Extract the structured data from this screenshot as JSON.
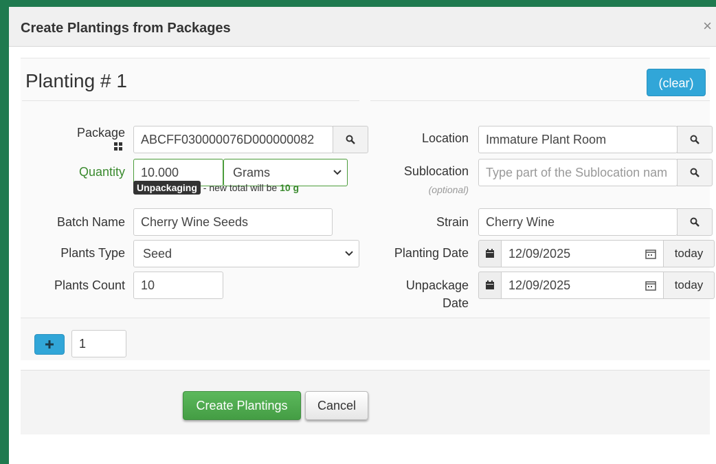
{
  "dialog": {
    "title": "Create Plantings from Packages",
    "close_symbol": "×"
  },
  "planting": {
    "heading": "Planting # 1",
    "clear_label": "(clear)"
  },
  "left_form": {
    "package": {
      "label": "Package",
      "value": "ABCFF030000076D000000082",
      "icon": "grid-icon"
    },
    "quantity": {
      "label": "Quantity",
      "value": "10.000",
      "unit": "Grams"
    },
    "unpackaging": {
      "badge": "Unpackaging",
      "text": "- new total will be",
      "total": "10 g"
    },
    "batch_name": {
      "label": "Batch Name",
      "value": "Cherry Wine Seeds"
    },
    "plants_type": {
      "label": "Plants Type",
      "value": "Seed"
    },
    "plants_count": {
      "label": "Plants Count",
      "value": "10"
    }
  },
  "right_form": {
    "location": {
      "label": "Location",
      "value": "Immature Plant Room"
    },
    "sublocation": {
      "label": "Sublocation",
      "optional": "(optional)",
      "placeholder": "Type part of the Sublocation nam"
    },
    "strain": {
      "label": "Strain",
      "value": "Cherry Wine"
    },
    "planting_date": {
      "label": "Planting Date",
      "value": "12/09/2025",
      "today_label": "today"
    },
    "unpackage_date": {
      "label_line1": "Unpackage",
      "label_line2": "Date",
      "value": "12/09/2025",
      "today_label": "today"
    }
  },
  "add_row": {
    "count_value": "1"
  },
  "footer": {
    "create_label": "Create Plantings",
    "cancel_label": "Cancel"
  },
  "colors": {
    "green_accent": "#3a8a2e",
    "blue_button": "#31a6d8",
    "create_green": "#5cb85c",
    "border_green": "#1f7a4f"
  }
}
